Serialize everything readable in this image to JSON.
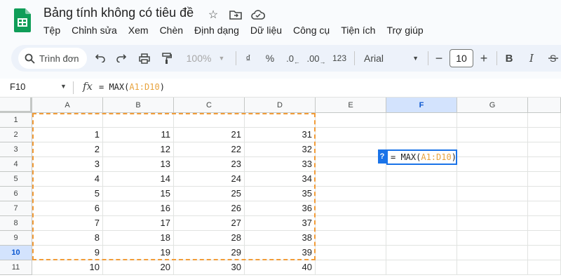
{
  "doc": {
    "title": "Bảng tính không có tiêu đề"
  },
  "menu": [
    "Tệp",
    "Chỉnh sửa",
    "Xem",
    "Chèn",
    "Định dạng",
    "Dữ liệu",
    "Công cụ",
    "Tiện ích",
    "Trợ giúp"
  ],
  "toolbar": {
    "search_label": "Trình đơn",
    "zoom": "100%",
    "currency": "₫",
    "percent": "%",
    "dec_decrease": ".0",
    "dec_increase": ".00",
    "number_format": "123",
    "font": "Arial",
    "font_size": "10",
    "minus": "−",
    "plus": "+",
    "bold": "B",
    "italic": "I"
  },
  "formula_bar": {
    "name_box": "F10",
    "fx": "fx",
    "formula_prefix": "= MAX(",
    "formula_range": "A1:D10",
    "formula_suffix": ")"
  },
  "grid": {
    "columns": [
      "A",
      "B",
      "C",
      "D",
      "E",
      "F",
      "G"
    ],
    "rows": [
      "1",
      "2",
      "3",
      "4",
      "5",
      "6",
      "7",
      "8",
      "9",
      "10",
      "11"
    ],
    "selected_column": "F",
    "selected_row": "10",
    "values": [
      [
        "",
        "",
        "",
        ""
      ],
      [
        "1",
        "11",
        "21",
        "31"
      ],
      [
        "2",
        "12",
        "22",
        "32"
      ],
      [
        "3",
        "13",
        "23",
        "33"
      ],
      [
        "4",
        "14",
        "24",
        "34"
      ],
      [
        "5",
        "15",
        "25",
        "35"
      ],
      [
        "6",
        "16",
        "26",
        "36"
      ],
      [
        "7",
        "17",
        "27",
        "37"
      ],
      [
        "8",
        "18",
        "28",
        "38"
      ],
      [
        "9",
        "19",
        "29",
        "39"
      ],
      [
        "10",
        "20",
        "30",
        "40"
      ]
    ]
  },
  "editor": {
    "help": "?",
    "prefix": "= MAX(",
    "range": "A1:D10",
    "suffix": ")"
  },
  "colors": {
    "accent": "#1a73e8",
    "range": "#f29c38",
    "sheets_green": "#0f9d58"
  }
}
